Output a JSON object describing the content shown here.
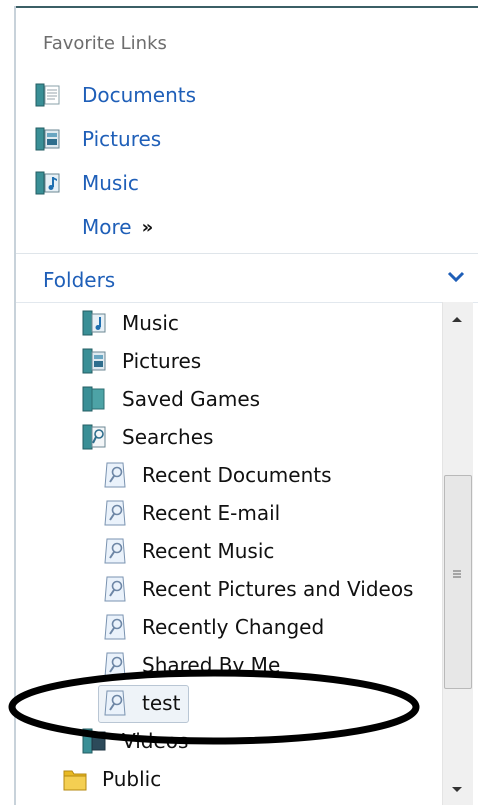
{
  "favorite_links": {
    "title": "Favorite Links",
    "items": [
      {
        "label": "Documents",
        "icon": "documents-library-icon"
      },
      {
        "label": "Pictures",
        "icon": "pictures-library-icon"
      },
      {
        "label": "Music",
        "icon": "music-library-icon"
      }
    ],
    "more_label": "More",
    "more_glyph": "»"
  },
  "folders": {
    "title": "Folders",
    "tree": [
      {
        "label": "Music",
        "icon": "music-folder-icon"
      },
      {
        "label": "Pictures",
        "icon": "pictures-folder-icon"
      },
      {
        "label": "Saved Games",
        "icon": "saved-games-folder-icon"
      },
      {
        "label": "Searches",
        "icon": "searches-folder-icon"
      },
      {
        "label": "Recent Documents",
        "icon": "saved-search-icon"
      },
      {
        "label": "Recent E-mail",
        "icon": "saved-search-icon"
      },
      {
        "label": "Recent Music",
        "icon": "saved-search-icon"
      },
      {
        "label": "Recent Pictures and Videos",
        "icon": "saved-search-icon"
      },
      {
        "label": "Recently Changed",
        "icon": "saved-search-icon"
      },
      {
        "label": "Shared By Me",
        "icon": "saved-search-icon"
      },
      {
        "label": "test",
        "icon": "saved-search-icon",
        "selected": true
      },
      {
        "label": "Videos",
        "icon": "videos-folder-icon"
      },
      {
        "label": "Public",
        "icon": "yellow-folder-icon"
      }
    ]
  },
  "colors": {
    "link": "#1f5fb8",
    "annotation": "#000000"
  }
}
